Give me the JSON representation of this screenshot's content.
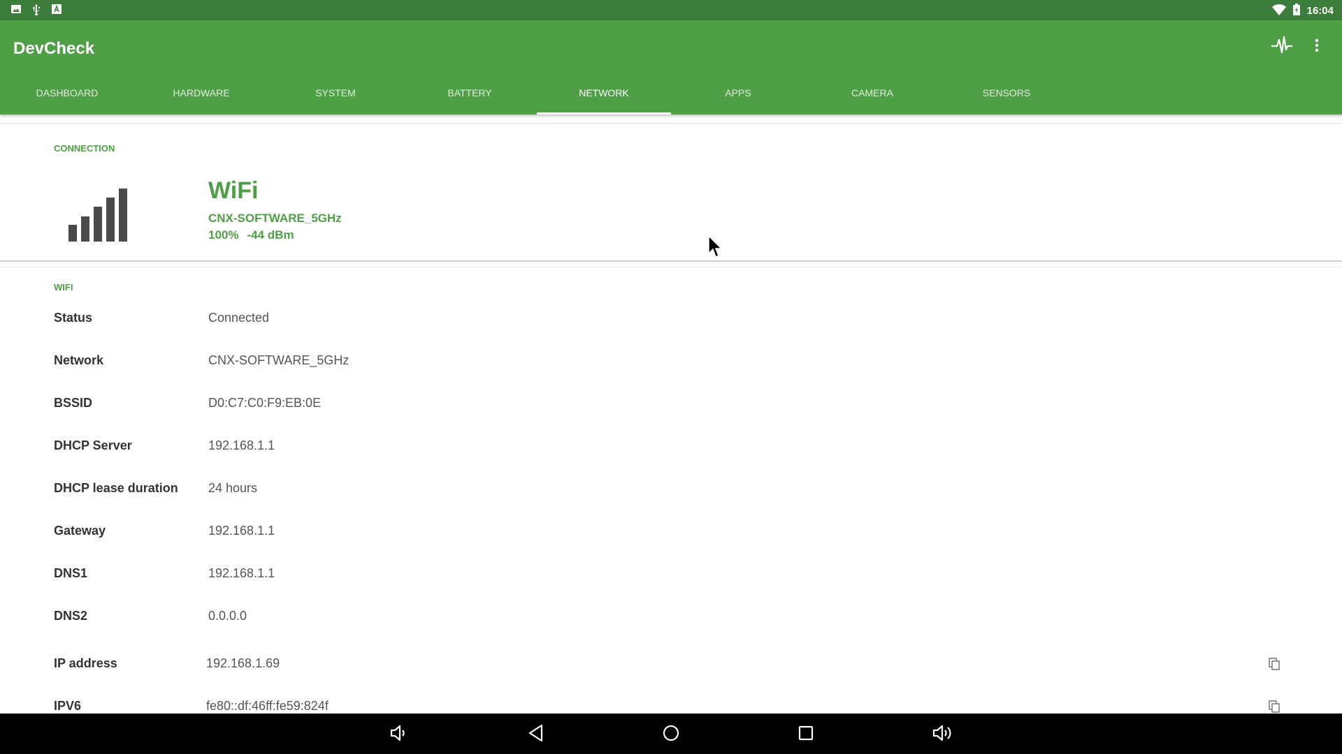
{
  "status_bar": {
    "left_icons": [
      "image-icon",
      "usb-icon",
      "text-icon"
    ],
    "right_icons": [
      "wifi-icon",
      "battery-icon"
    ],
    "time": "16:04"
  },
  "app_bar": {
    "title": "DevCheck",
    "actions": [
      "activity-icon",
      "more-vert-icon"
    ],
    "tabs": [
      {
        "label": "DASHBOARD",
        "active": false
      },
      {
        "label": "HARDWARE",
        "active": false
      },
      {
        "label": "SYSTEM",
        "active": false
      },
      {
        "label": "BATTERY",
        "active": false
      },
      {
        "label": "NETWORK",
        "active": true
      },
      {
        "label": "APPS",
        "active": false
      },
      {
        "label": "CAMERA",
        "active": false
      },
      {
        "label": "SENSORS",
        "active": false
      }
    ]
  },
  "connection": {
    "heading": "CONNECTION",
    "icon": "signal-bars-icon",
    "type": "WiFi",
    "ssid": "CNX-SOFTWARE_5GHz",
    "percent": "100%",
    "dbm": "-44 dBm"
  },
  "wifi": {
    "heading": "WIFI",
    "rows": [
      {
        "label": "Status",
        "value": "Connected"
      },
      {
        "label": "Network",
        "value": "CNX-SOFTWARE_5GHz"
      },
      {
        "label": "BSSID",
        "value": "D0:C7:C0:F9:EB:0E"
      },
      {
        "label": "DHCP Server",
        "value": "192.168.1.1"
      },
      {
        "label": "DHCP lease duration",
        "value": "24 hours"
      },
      {
        "label": "Gateway",
        "value": "192.168.1.1"
      },
      {
        "label": "DNS1",
        "value": "192.168.1.1"
      },
      {
        "label": "DNS2",
        "value": "0.0.0.0"
      },
      {
        "label": "IP address",
        "value": "192.168.1.69",
        "copy": true
      },
      {
        "label": "IPV6",
        "value": "fe80::df:46ff:fe59:824f",
        "copy": true
      }
    ]
  },
  "nav_bar": {
    "buttons": [
      "volume-down-icon",
      "back-icon",
      "home-icon",
      "recents-icon",
      "volume-up-icon"
    ]
  },
  "colors": {
    "status_bar": "#3c7d3b",
    "app_bar": "#4e9f45",
    "accent": "#4e9f45",
    "signal_icon": "#4a4a4a"
  }
}
